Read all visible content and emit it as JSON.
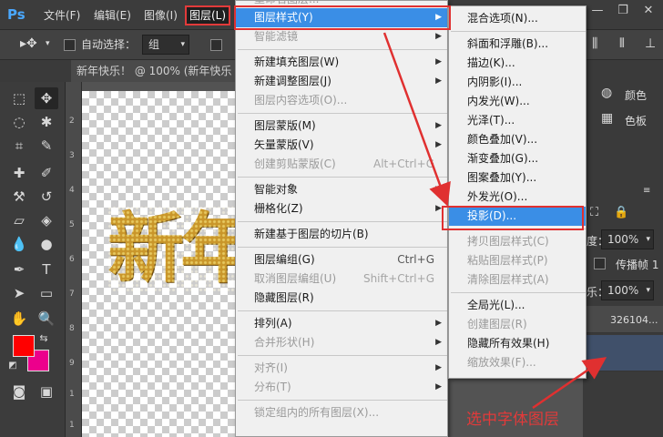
{
  "menubar": {
    "logo": "Ps",
    "items": [
      "文件(F)",
      "编辑(E)",
      "图像(I)",
      "图层(L)"
    ],
    "window_controls": [
      "minimize-icon",
      "restore-icon",
      "close-icon"
    ]
  },
  "options": {
    "auto_select_label": "自动选择：",
    "auto_select_value": "组"
  },
  "document_tab": "新年快乐！ @ 100% (新年快乐",
  "ruler_marks": [
    "2",
    "3",
    "4",
    "5",
    "6",
    "7",
    "8",
    "9",
    "1",
    "1"
  ],
  "canvas_text": "新年",
  "layer_menu": {
    "partial_top": "重命名图层...",
    "items": [
      {
        "label": "图层样式(Y)",
        "submenu": true,
        "highlight": true
      },
      {
        "label": "智能滤镜",
        "submenu": true,
        "disabled": true
      },
      {
        "separator": true
      },
      {
        "label": "新建填充图层(W)",
        "submenu": true
      },
      {
        "label": "新建调整图层(J)",
        "submenu": true
      },
      {
        "label": "图层内容选项(O)...",
        "disabled": true
      },
      {
        "separator": true
      },
      {
        "label": "图层蒙版(M)",
        "submenu": true
      },
      {
        "label": "矢量蒙版(V)",
        "submenu": true
      },
      {
        "label": "创建剪贴蒙版(C)",
        "shortcut": "Alt+Ctrl+G",
        "disabled": true
      },
      {
        "separator": true
      },
      {
        "label": "智能对象",
        "submenu": true
      },
      {
        "label": "栅格化(Z)",
        "submenu": true
      },
      {
        "separator": true
      },
      {
        "label": "新建基于图层的切片(B)"
      },
      {
        "separator": true
      },
      {
        "label": "图层编组(G)",
        "shortcut": "Ctrl+G"
      },
      {
        "label": "取消图层编组(U)",
        "shortcut": "Shift+Ctrl+G",
        "disabled": true
      },
      {
        "label": "隐藏图层(R)"
      },
      {
        "separator": true
      },
      {
        "label": "排列(A)",
        "submenu": true
      },
      {
        "label": "合并形状(H)",
        "submenu": true,
        "disabled": true
      },
      {
        "separator": true
      },
      {
        "label": "对齐(I)",
        "submenu": true,
        "disabled": true
      },
      {
        "label": "分布(T)",
        "submenu": true,
        "disabled": true
      },
      {
        "separator": true
      },
      {
        "label": "锁定组内的所有图层(X)...",
        "disabled": true
      }
    ]
  },
  "style_submenu": {
    "items": [
      {
        "label": "混合选项(N)..."
      },
      {
        "separator": true
      },
      {
        "label": "斜面和浮雕(B)..."
      },
      {
        "label": "描边(K)..."
      },
      {
        "label": "内阴影(I)..."
      },
      {
        "label": "内发光(W)..."
      },
      {
        "label": "光泽(T)..."
      },
      {
        "label": "颜色叠加(V)..."
      },
      {
        "label": "渐变叠加(G)..."
      },
      {
        "label": "图案叠加(Y)..."
      },
      {
        "label": "外发光(O)..."
      },
      {
        "label": "投影(D)...",
        "highlight": true
      },
      {
        "separator": true
      },
      {
        "label": "拷贝图层样式(C)",
        "disabled": true
      },
      {
        "label": "粘贴图层样式(P)",
        "disabled": true
      },
      {
        "label": "清除图层样式(A)",
        "disabled": true
      },
      {
        "separator": true
      },
      {
        "label": "全局光(L)..."
      },
      {
        "label": "创建图层(R)",
        "disabled": true
      },
      {
        "label": "隐藏所有效果(H)"
      },
      {
        "label": "缩放效果(F)...",
        "disabled": true
      }
    ]
  },
  "right_panel": {
    "color_label": "颜色",
    "swatches_label": "色板",
    "opacity_value": "100%",
    "opacity_label": "度：",
    "fill_value": "100%",
    "fill_label": "乐：",
    "propagate_label": "传播帧 1",
    "layer_name": "326104..."
  },
  "caption": "选中字体图层",
  "colors": {
    "foreground": "#ff0000",
    "background": "#ec008c",
    "highlight": "#3a8ee6",
    "annotation": "#e23a3a"
  }
}
